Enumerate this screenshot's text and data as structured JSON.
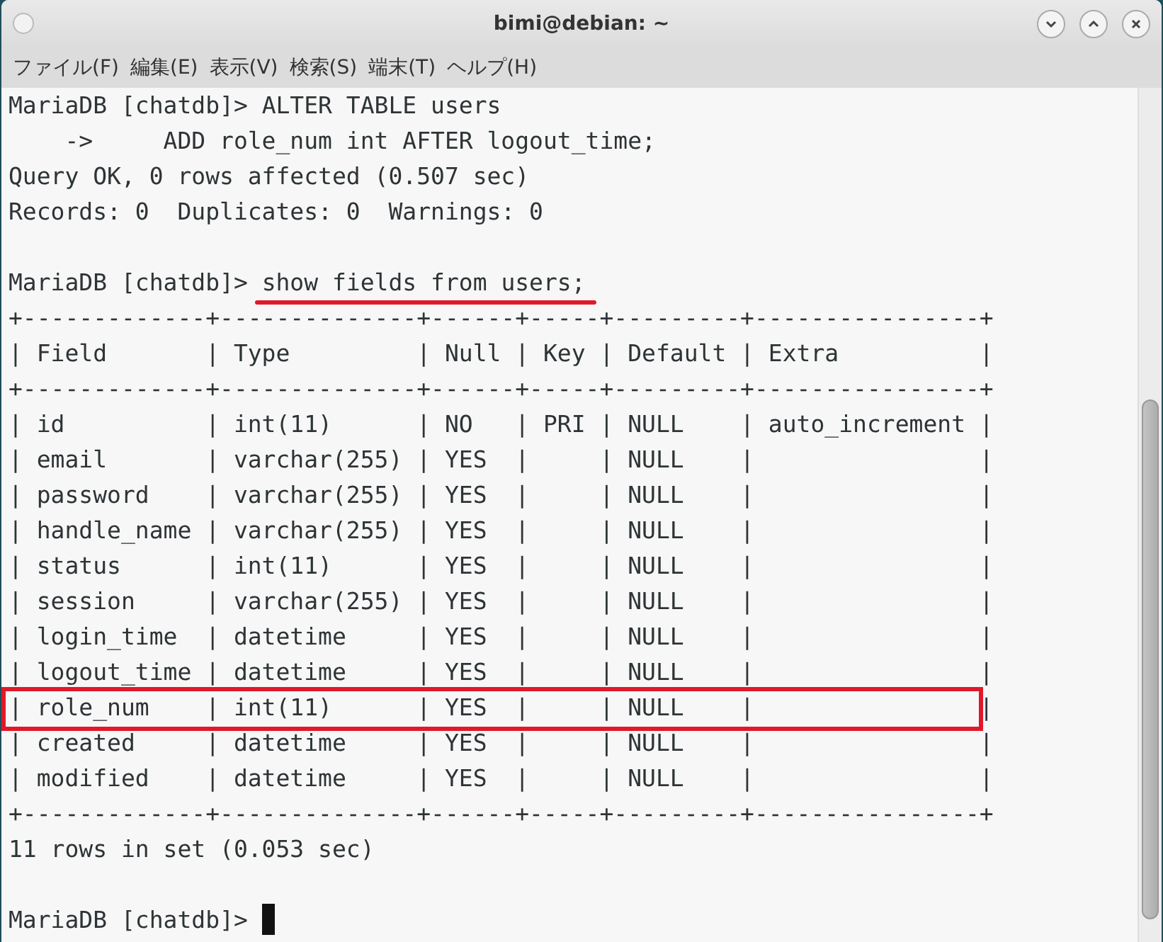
{
  "window": {
    "title": "bimi@debian: ~"
  },
  "menu": [
    "ファイル(F)",
    "編集(E)",
    "表示(V)",
    "検索(S)",
    "端末(T)",
    "ヘルプ(H)"
  ],
  "terminal": {
    "lines": [
      {
        "kind": "prompt",
        "prompt": "MariaDB [chatdb]> ",
        "command": "ALTER TABLE users",
        "underlined": false
      },
      {
        "kind": "output",
        "text": "    ->     ADD role_num int AFTER logout_time;",
        "boxed": false
      },
      {
        "kind": "output",
        "text": "Query OK, 0 rows affected (0.507 sec)",
        "boxed": false
      },
      {
        "kind": "output",
        "text": "Records: 0  Duplicates: 0  Warnings: 0",
        "boxed": false
      },
      {
        "kind": "blank"
      },
      {
        "kind": "prompt",
        "prompt": "MariaDB [chatdb]> ",
        "command": "show fields from users;",
        "underlined": true
      },
      {
        "kind": "output",
        "text": "+-------------+--------------+------+-----+---------+----------------+",
        "boxed": false
      },
      {
        "kind": "output",
        "text": "| Field       | Type         | Null | Key | Default | Extra          |",
        "boxed": false
      },
      {
        "kind": "output",
        "text": "+-------------+--------------+------+-----+---------+----------------+",
        "boxed": false
      },
      {
        "kind": "output",
        "text": "| id          | int(11)      | NO   | PRI | NULL    | auto_increment |",
        "boxed": false
      },
      {
        "kind": "output",
        "text": "| email       | varchar(255) | YES  |     | NULL    |                |",
        "boxed": false
      },
      {
        "kind": "output",
        "text": "| password    | varchar(255) | YES  |     | NULL    |                |",
        "boxed": false
      },
      {
        "kind": "output",
        "text": "| handle_name | varchar(255) | YES  |     | NULL    |                |",
        "boxed": false
      },
      {
        "kind": "output",
        "text": "| status      | int(11)      | YES  |     | NULL    |                |",
        "boxed": false
      },
      {
        "kind": "output",
        "text": "| session     | varchar(255) | YES  |     | NULL    |                |",
        "boxed": false
      },
      {
        "kind": "output",
        "text": "| login_time  | datetime     | YES  |     | NULL    |                |",
        "boxed": false
      },
      {
        "kind": "output",
        "text": "| logout_time | datetime     | YES  |     | NULL    |                |",
        "boxed": false
      },
      {
        "kind": "output",
        "text": "| role_num    | int(11)      | YES  |     | NULL    |                |",
        "boxed": true
      },
      {
        "kind": "output",
        "text": "| created     | datetime     | YES  |     | NULL    |                |",
        "boxed": false
      },
      {
        "kind": "output",
        "text": "| modified    | datetime     | YES  |     | NULL    |                |",
        "boxed": false
      },
      {
        "kind": "output",
        "text": "+-------------+--------------+------+-----+---------+----------------+",
        "boxed": false
      },
      {
        "kind": "output",
        "text": "11 rows in set (0.053 sec)",
        "boxed": false
      },
      {
        "kind": "blank"
      },
      {
        "kind": "prompt",
        "prompt": "MariaDB [chatdb]> ",
        "underlined": false,
        "cursor": true
      }
    ]
  }
}
